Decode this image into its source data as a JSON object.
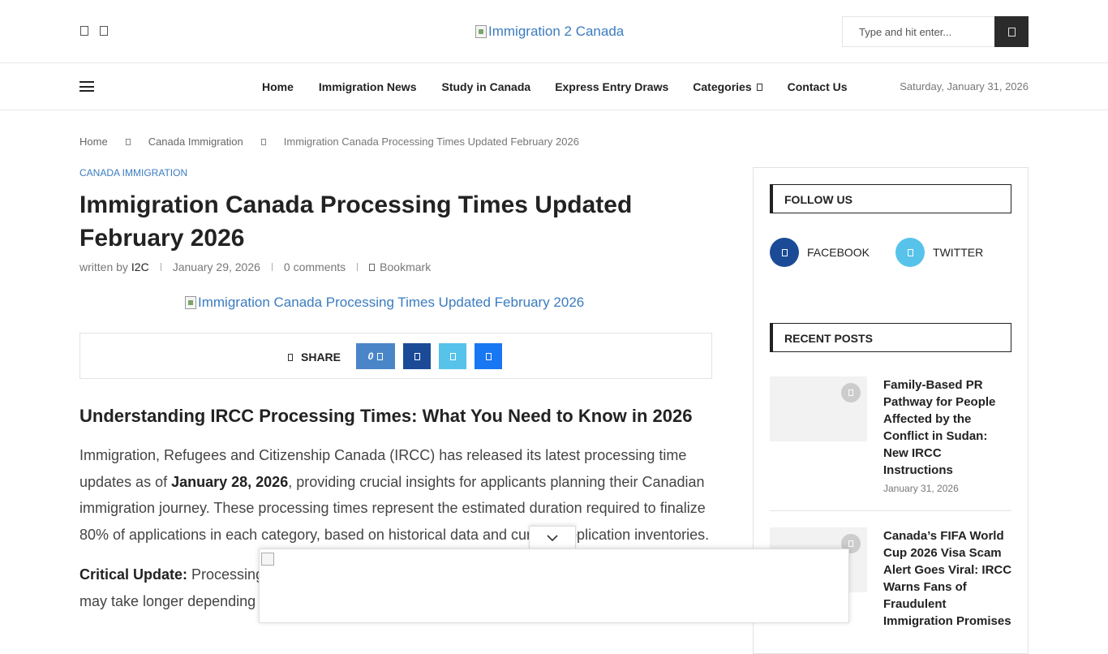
{
  "header": {
    "logo_alt": "Immigration 2 Canada",
    "search_placeholder": "Type and hit enter..."
  },
  "nav": {
    "items": [
      "Home",
      "Immigration News",
      "Study in Canada",
      "Express Entry Draws",
      "Categories",
      "Contact Us"
    ],
    "date": "Saturday, January 31, 2026"
  },
  "breadcrumb": {
    "home": "Home",
    "category": "Canada Immigration",
    "current": "Immigration Canada Processing Times Updated February 2026"
  },
  "article": {
    "category": "CANADA IMMIGRATION",
    "title": "Immigration Canada Processing Times Updated February 2026",
    "written_by": "written by",
    "author": "I2C",
    "date": "January 29, 2026",
    "comments": "0 comments",
    "bookmark": "Bookmark",
    "featured_alt": "Immigration Canada Processing Times Updated February 2026",
    "share_label": "SHARE",
    "share_count": "0",
    "heading": "Understanding IRCC Processing Times: What You Need to Know in 2026",
    "para1_a": "Immigration, Refugees and Citizenship Canada (IRCC) has released its latest processing time updates as of ",
    "para1_bold": "January 28, 2026",
    "para1_b": ", providing crucial insights for applicants planning their Canadian immigration journey. These processing times represent the estimated duration required to finalize 80% of applications in each category, based on historical data and current application inventories.",
    "para2_bold": "Critical Update:",
    "para2_a": " Processing",
    "para2_b": "may take longer depending"
  },
  "sidebar": {
    "follow_title": "FOLLOW US",
    "facebook": "FACEBOOK",
    "twitter": "TWITTER",
    "recent_title": "RECENT POSTS",
    "posts": [
      {
        "title": "Family-Based PR Pathway for People Affected by the Conflict in Sudan: New IRCC Instructions",
        "date": "January 31, 2026"
      },
      {
        "title": "Canada’s FIFA World Cup 2026 Visa Scam Alert Goes Viral: IRCC Warns Fans of Fraudulent Immigration Promises",
        "date": ""
      }
    ]
  },
  "colors": {
    "link_blue": "#3a7cc0",
    "share_count_bg": "#4a86c7",
    "facebook": "#1b4b97",
    "twitter": "#57c3ea",
    "messenger": "#1877f2",
    "search_btn": "#2b2b2b"
  },
  "icons": [
    "facebook-icon",
    "twitter-icon",
    "search-icon",
    "menu-icon",
    "chevron-down-icon",
    "bookmark-icon",
    "share-icon",
    "messenger-icon",
    "camera-icon",
    "chevron-right-icon"
  ]
}
